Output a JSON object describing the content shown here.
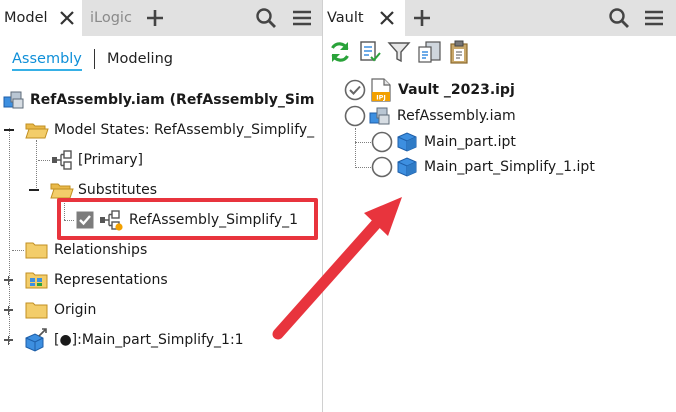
{
  "left_panel": {
    "tabs": [
      {
        "label": "Model",
        "active": true
      },
      {
        "label": "iLogic",
        "active": false
      }
    ],
    "subtabs": {
      "assembly": "Assembly",
      "modeling": "Modeling"
    },
    "tree": {
      "root": "RefAssembly.iam (RefAssembly_Sim",
      "model_states": "Model States: RefAssembly_Simplify_",
      "primary": "[Primary]",
      "substitutes": "Substitutes",
      "substitute_item": "RefAssembly_Simplify_1",
      "relationships": "Relationships",
      "representations": "Representations",
      "origin": "Origin",
      "main_part": "[●]:Main_part_Simplify_1:1"
    }
  },
  "right_panel": {
    "tab": {
      "label": "Vault",
      "active": true
    },
    "tree": {
      "project": "Vault _2023.ipj",
      "assembly": "RefAssembly.iam",
      "part1": "Main_part.ipt",
      "part2": "Main_part_Simplify_1.ipt"
    },
    "project_badge": "IPJ"
  },
  "colors": {
    "accent_blue": "#0f8fd8",
    "highlight_red": "#e8343d",
    "folder_yellow": "#f3cd6a",
    "refresh_green": "#2aa33a",
    "part_blue": "#3d8fe0"
  }
}
